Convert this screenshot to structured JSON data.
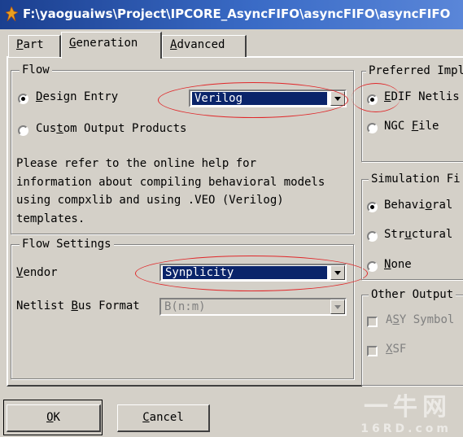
{
  "window": {
    "title": "F:\\yaoguaiws\\Project\\IPCORE_AsyncFIFO\\asyncFIFO\\asyncFIFO"
  },
  "tabs": [
    {
      "pre": "",
      "key": "P",
      "post": "art"
    },
    {
      "pre": "",
      "key": "G",
      "post": "eneration"
    },
    {
      "pre": "",
      "key": "A",
      "post": "dvanced"
    }
  ],
  "flow": {
    "title": "Flow",
    "design_entry": {
      "pre": "",
      "key": "D",
      "post": "esign Entry"
    },
    "design_entry_value": "Verilog",
    "custom_output": {
      "pre": "Cus",
      "key": "t",
      "post": "om Output Products"
    },
    "description": "Please refer to the online help for\ninformation about compiling behavioral models\nusing compxlib and using .VEO (Verilog)\ntemplates."
  },
  "flow_settings": {
    "title": "Flow Settings",
    "vendor": {
      "pre": "",
      "key": "V",
      "post": "endor"
    },
    "vendor_value": "Synplicity",
    "netlist_bus_format": {
      "pre": "Netlist ",
      "key": "B",
      "post": "us Format"
    },
    "netlist_bus_format_value": "B(n:m)"
  },
  "preferred_impl": {
    "title": "Preferred Impl",
    "edif": {
      "pre": "",
      "key": "E",
      "post": "DIF Netlis"
    },
    "ngc": {
      "pre": "NGC ",
      "key": "F",
      "post": "ile"
    }
  },
  "simulation": {
    "title": "Simulation Fi",
    "behavioral": {
      "pre": "Behavi",
      "key": "o",
      "post": "ral"
    },
    "structural": {
      "pre": "Str",
      "key": "u",
      "post": "ctural"
    },
    "none": {
      "pre": "",
      "key": "N",
      "post": "one"
    }
  },
  "other_output": {
    "title": "Other Output",
    "asy": {
      "pre": "A",
      "key": "S",
      "post": "Y Symbol"
    },
    "xsf": {
      "pre": "",
      "key": "X",
      "post": "SF"
    }
  },
  "buttons": {
    "ok": {
      "pre": "",
      "key": "O",
      "post": "K"
    },
    "cancel": {
      "pre": "",
      "key": "C",
      "post": "ancel"
    }
  },
  "watermark": {
    "main": "一牛网",
    "sub": "16RD.com"
  },
  "icons": {
    "app": "xilinx-core-icon",
    "dropdown": "chevron-down-icon"
  },
  "colors": {
    "selection": "#0a246a",
    "annotation": "#e0282a",
    "titlebar": "#1b3f8f"
  }
}
